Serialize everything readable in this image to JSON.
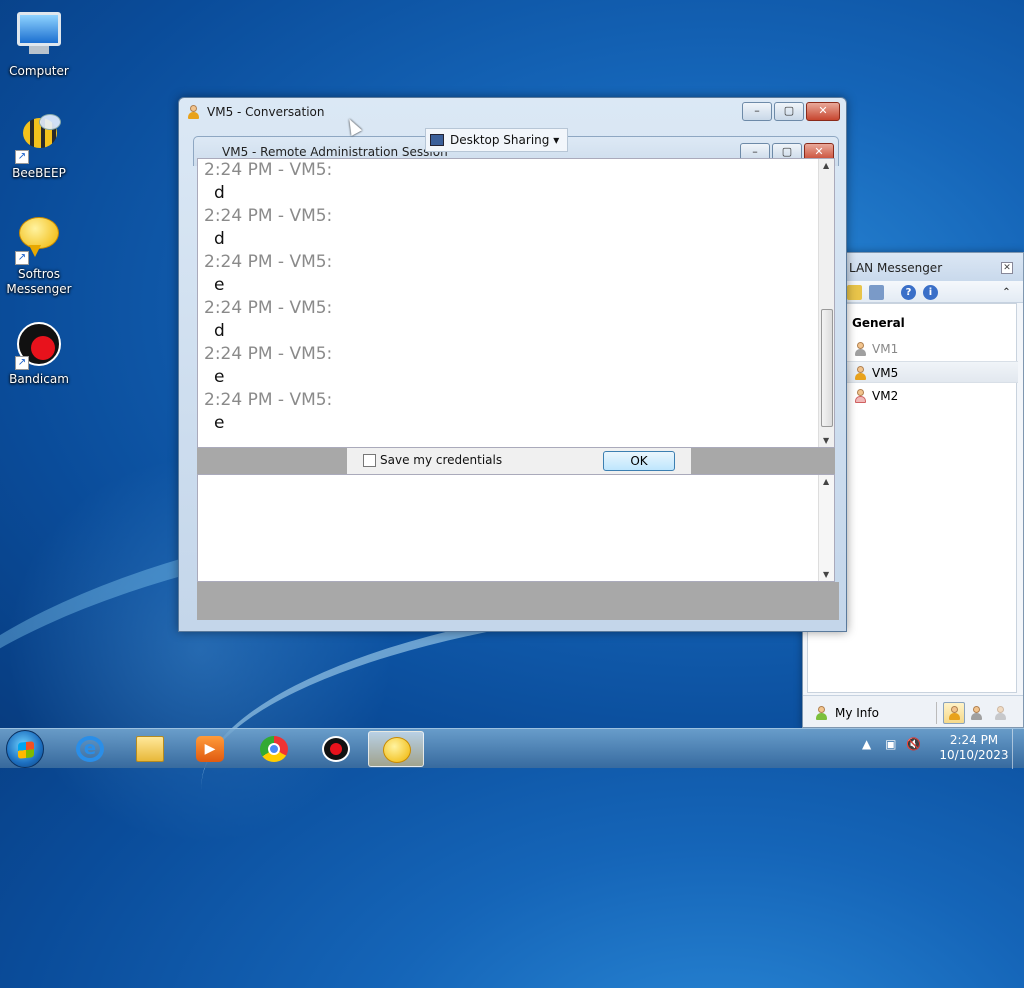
{
  "desktop": {
    "icons": [
      {
        "label": "Computer",
        "icon": "computer-icon"
      },
      {
        "label": "BeeBEEP",
        "icon": "bee-icon"
      },
      {
        "label": "Softros Messenger",
        "icon": "softros-icon"
      },
      {
        "label": "Bandicam",
        "icon": "bandicam-icon"
      }
    ]
  },
  "conversation": {
    "title": "VM5 - Conversation",
    "inner_title": "VM5 - Remote Administration Session",
    "share_label": "Desktop Sharing",
    "messages": [
      {
        "head": "2:24 PM - VM5:",
        "body": "d"
      },
      {
        "head": "2:24 PM - VM5:",
        "body": "d"
      },
      {
        "head": "2:24 PM - VM5:",
        "body": "e"
      },
      {
        "head": "2:24 PM - VM5:",
        "body": "d"
      },
      {
        "head": "2:24 PM - VM5:",
        "body": "e"
      },
      {
        "head": "2:24 PM - VM5:",
        "body": "e"
      }
    ],
    "save_credentials_label": "Save my credentials",
    "save_credentials_checked": false,
    "ok_label": "OK",
    "message_input_value": ""
  },
  "lan": {
    "title": "LAN Messenger",
    "group": "General",
    "users": [
      {
        "name": "VM1",
        "status": "offline",
        "selected": false
      },
      {
        "name": "VM5",
        "status": "available",
        "selected": true
      },
      {
        "name": "VM2",
        "status": "busy",
        "selected": false
      }
    ],
    "my_info": "My Info"
  },
  "taskbar": {
    "items": [
      "internet-explorer-icon",
      "file-explorer-icon",
      "media-player-icon",
      "chrome-icon",
      "bandicam-icon",
      "softros-messenger-icon"
    ],
    "active_item": "softros-messenger-icon",
    "time": "2:24 PM",
    "date": "10/10/2023"
  },
  "colors": {
    "close_button": "#c7462f",
    "ok_button_border": "#3c7fb1",
    "desktop_bg": "#1565b8"
  }
}
